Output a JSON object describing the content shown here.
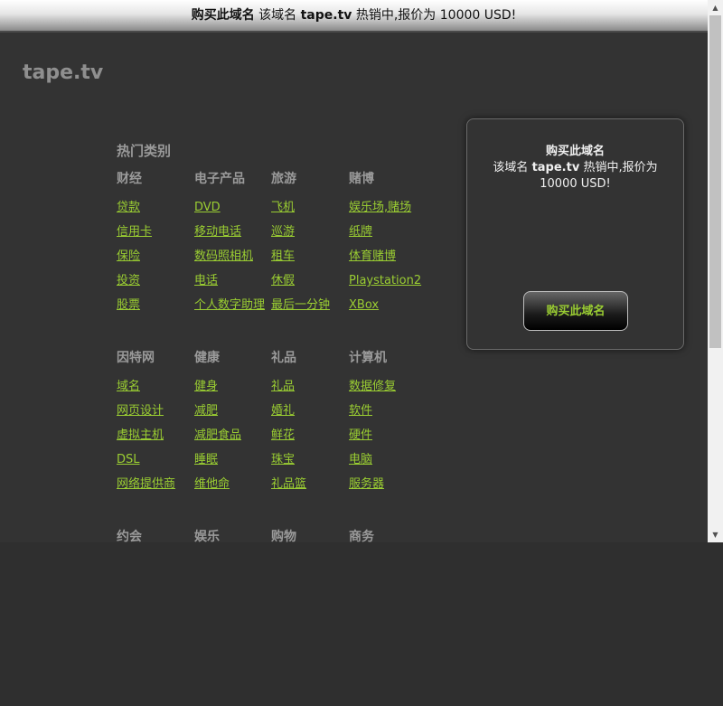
{
  "banner": {
    "label": "购买此域名",
    "text_prefix": "该域名",
    "domain": "tape.tv",
    "text_suffix": "热销中,报价为 10000 USD!"
  },
  "logo": "tape.tv",
  "categories": {
    "title": "热门类别",
    "groups": [
      {
        "columns": [
          {
            "heading": "财经",
            "items": [
              "贷款",
              "信用卡",
              "保险",
              "投资",
              "股票"
            ]
          },
          {
            "heading": "电子产品",
            "items": [
              "DVD",
              "移动电话",
              "数码照相机",
              "电话",
              "个人数字助理"
            ]
          },
          {
            "heading": "旅游",
            "items": [
              "飞机",
              "巡游",
              "租车",
              "休假",
              "最后一分钟"
            ]
          },
          {
            "heading": "赌博",
            "items": [
              "娱乐场,赌场",
              "纸牌",
              "体育赌博",
              "Playstation2",
              "XBox"
            ]
          }
        ]
      },
      {
        "columns": [
          {
            "heading": "因特网",
            "items": [
              "域名",
              "网页设计",
              "虚拟主机",
              "DSL",
              "网络提供商"
            ]
          },
          {
            "heading": "健康",
            "items": [
              "健身",
              "减肥",
              "减肥食品",
              "睡眠",
              "维他命"
            ]
          },
          {
            "heading": "礼品",
            "items": [
              "礼品",
              "婚礼",
              "鲜花",
              "珠宝",
              "礼品篮"
            ]
          },
          {
            "heading": "计算机",
            "items": [
              "数据修复",
              "软件",
              "硬件",
              "电脑",
              "服务器"
            ]
          }
        ]
      },
      {
        "columns": [
          {
            "heading": "约会",
            "items": []
          },
          {
            "heading": "娱乐",
            "items": []
          },
          {
            "heading": "购物",
            "items": []
          },
          {
            "heading": "商务",
            "items": []
          }
        ]
      }
    ]
  },
  "buybox": {
    "title": "购买此域名",
    "desc_prefix": "该域名",
    "domain": "tape.tv",
    "desc_suffix": "热销中,报价为 10000 USD!",
    "button": "购买此域名"
  },
  "colors": {
    "link": "#9acd32",
    "background": "#333333"
  }
}
